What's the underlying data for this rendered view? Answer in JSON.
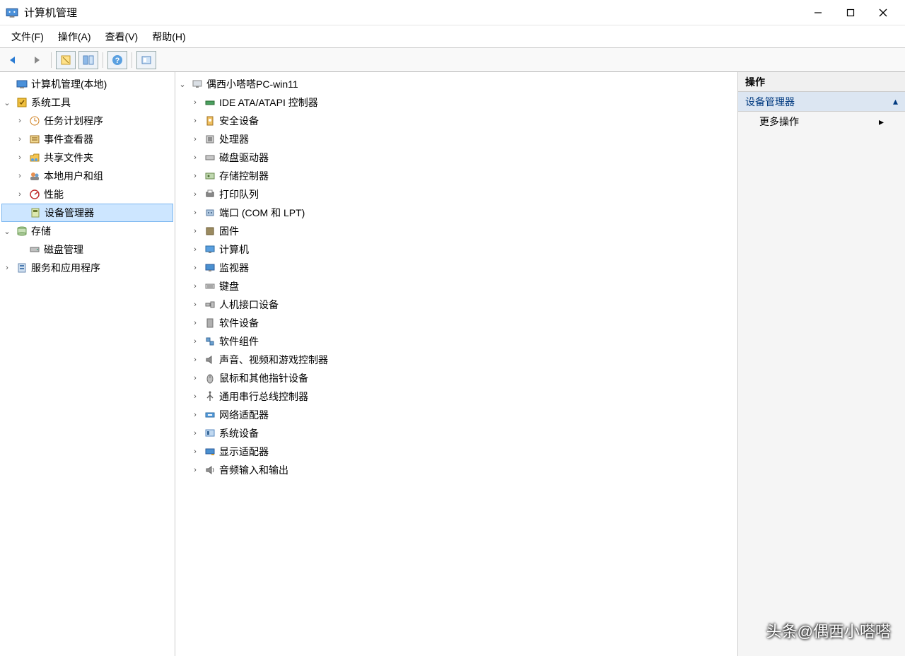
{
  "window": {
    "title": "计算机管理"
  },
  "menubar": {
    "file": "文件(F)",
    "action": "操作(A)",
    "view": "查看(V)",
    "help": "帮助(H)"
  },
  "left_tree": {
    "root": "计算机管理(本地)",
    "system_tools": "系统工具",
    "task_scheduler": "任务计划程序",
    "event_viewer": "事件查看器",
    "shared_folders": "共享文件夹",
    "local_users": "本地用户和组",
    "performance": "性能",
    "device_manager": "设备管理器",
    "storage": "存储",
    "disk_management": "磁盘管理",
    "services_apps": "服务和应用程序"
  },
  "center_tree": {
    "pc_name": "偶西小嗒嗒PC-win11",
    "ide_atapi": "IDE ATA/ATAPI 控制器",
    "security_devices": "安全设备",
    "processors": "处理器",
    "disk_drives": "磁盘驱动器",
    "storage_controllers": "存储控制器",
    "print_queues": "打印队列",
    "ports": "端口 (COM 和 LPT)",
    "firmware": "固件",
    "computer": "计算机",
    "monitors": "监视器",
    "keyboards": "键盘",
    "hid": "人机接口设备",
    "software_devices": "软件设备",
    "software_components": "软件组件",
    "sound_video_game": "声音、视频和游戏控制器",
    "mice": "鼠标和其他指针设备",
    "usb_controllers": "通用串行总线控制器",
    "network_adapters": "网络适配器",
    "system_devices": "系统设备",
    "display_adapters": "显示适配器",
    "audio_io": "音频输入和输出"
  },
  "right_pane": {
    "header": "操作",
    "section": "设备管理器",
    "more_actions": "更多操作"
  },
  "watermark": "头条@偶西小嗒嗒"
}
